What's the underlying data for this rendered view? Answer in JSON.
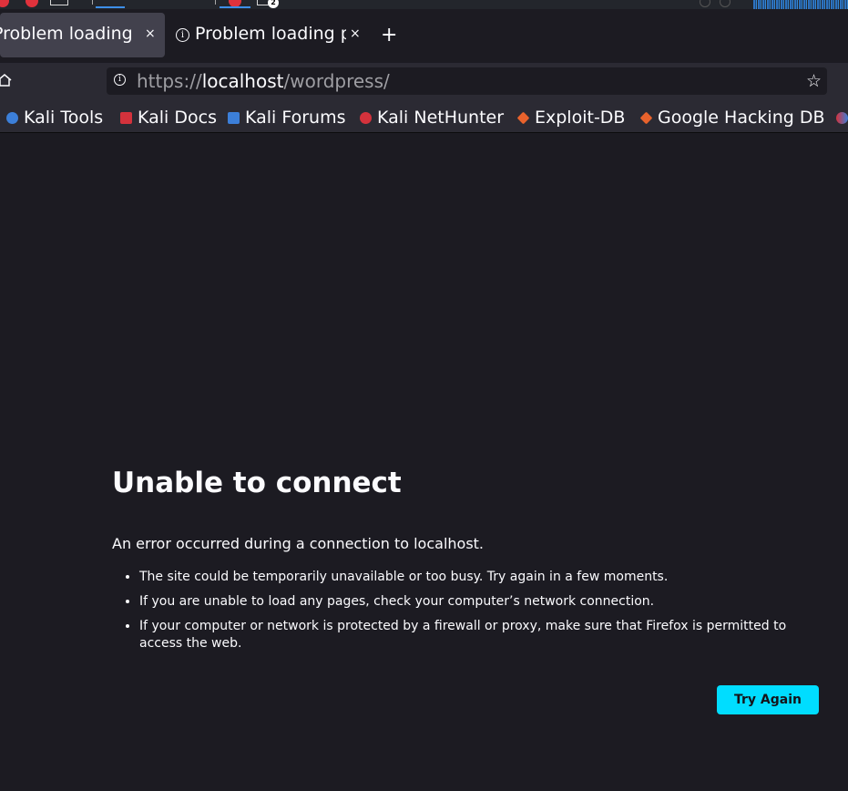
{
  "taskbar": {
    "badge": "2"
  },
  "tabs": [
    {
      "title": "Problem loading page",
      "close": "×",
      "selected": true
    },
    {
      "title": "Problem loading page",
      "close": "×",
      "selected": false
    }
  ],
  "new_tab": "+",
  "url": {
    "prefix": "https://",
    "host": "localhost",
    "path": "/wordpress/"
  },
  "bookmarks": [
    {
      "label": "Kali Tools",
      "icon_color": "#3c7fd9"
    },
    {
      "label": "Kali Docs",
      "icon_color": "#d4323c"
    },
    {
      "label": "Kali Forums",
      "icon_color": "#3c7fd9"
    },
    {
      "label": "Kali NetHunter",
      "icon_color": "#d4323c"
    },
    {
      "label": "Exploit-DB",
      "icon_color": "#e8622c"
    },
    {
      "label": "Google Hacking DB",
      "icon_color": "#e8622c"
    }
  ],
  "error": {
    "title": "Unable to connect",
    "description": "An error occurred during a connection to localhost.",
    "items": [
      "The site could be temporarily unavailable or too busy. Try again in a few moments.",
      "If you are unable to load any pages, check your computer’s network connection.",
      "If your computer or network is protected by a firewall or proxy, make sure that Firefox is permitted to access the web."
    ],
    "button": "Try Again"
  },
  "colors": {
    "accent": "#00ddff",
    "background": "#1c1b22",
    "toolbar": "#2b2a33"
  }
}
